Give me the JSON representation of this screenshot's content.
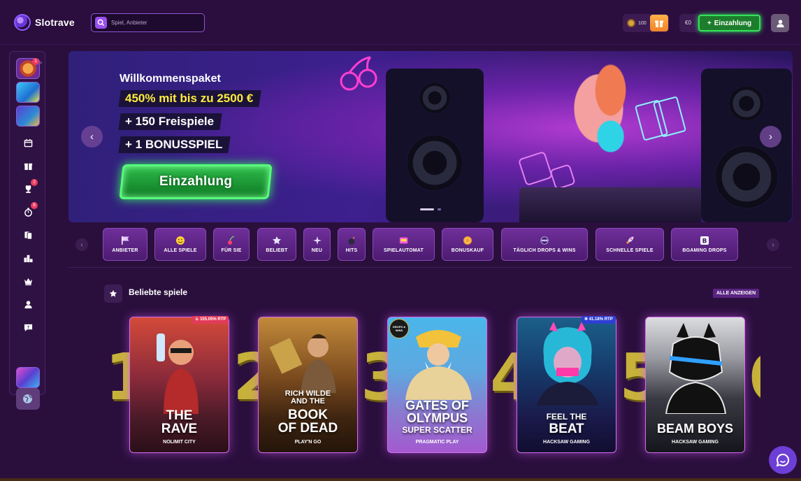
{
  "header": {
    "logo_text": "Slotrave",
    "search_placeholder": "Spiel, Anbieter",
    "coins": "100",
    "balance": "€0",
    "deposit_label": "Einzahlung"
  },
  "sidebar": {
    "badges": [
      "1",
      "2",
      "8"
    ]
  },
  "banner": {
    "title": "Willkommenspaket",
    "line1": "450% mit bis zu 2500 €",
    "line2": "+ 150 Freispiele",
    "line3": "+ 1 BONUSSPIEL",
    "cta": "Einzahlung",
    "arrow_prev": "‹",
    "arrow_next": "›"
  },
  "categories": [
    {
      "label": "ANBIETER",
      "icon": "flag-icon"
    },
    {
      "label": "ALLE SPIELE",
      "icon": "smiley-icon"
    },
    {
      "label": "FÜR SIE",
      "icon": "cherry-icon"
    },
    {
      "label": "BELIEBT",
      "icon": "star-icon"
    },
    {
      "label": "NEU",
      "icon": "sparkle-icon"
    },
    {
      "label": "HITS",
      "icon": "bomb-icon"
    },
    {
      "label": "SPIELAUTOMAT",
      "icon": "slot-machine-icon"
    },
    {
      "label": "BONUSKAUF",
      "icon": "coin-icon"
    },
    {
      "label": "TÄGLICH DROPS & WINS",
      "icon": "drops-wins-icon"
    },
    {
      "label": "SCHNELLE SPIELE",
      "icon": "rocket-icon"
    },
    {
      "label": "BGAMING DROPS",
      "icon": "bgaming-icon"
    }
  ],
  "popular": {
    "title": "Beliebte spiele",
    "show_all": "ALLE ANZEIGEN",
    "games": [
      {
        "rank": "1",
        "title_lines": [
          "THE",
          "RAVE"
        ],
        "studio": "NOLIMIT CITY",
        "rtp": "155.05% RTP",
        "rtp_color": "#e23b5b"
      },
      {
        "rank": "2",
        "title_lines": [
          "RICH WILDE",
          "AND THE",
          "BOOK",
          "OF DEAD"
        ],
        "studio": "PLAY'N GO",
        "rtp": "",
        "rtp_color": ""
      },
      {
        "rank": "3",
        "title_lines": [
          "GATES OF",
          "OLYMPUS",
          "SUPER SCATTER"
        ],
        "studio": "PRAGMATIC PLAY",
        "rtp": "",
        "rtp_color": "",
        "badge": "DROPS & WINS"
      },
      {
        "rank": "4",
        "title_lines": [
          "FEEL THE",
          "BEAT"
        ],
        "studio": "HACKSAW GAMING",
        "rtp": "41.18% RTP",
        "rtp_color": "#2e3fd4"
      },
      {
        "rank": "5",
        "title_lines": [
          "BEAM BOYS"
        ],
        "studio": "HACKSAW GAMING",
        "rtp": "",
        "rtp_color": ""
      }
    ]
  },
  "colors": {
    "accent_green": "#34e35a",
    "accent_purple": "#8a49b8",
    "rank_gold": "#c7b23a",
    "background": "#2a0f3d"
  }
}
